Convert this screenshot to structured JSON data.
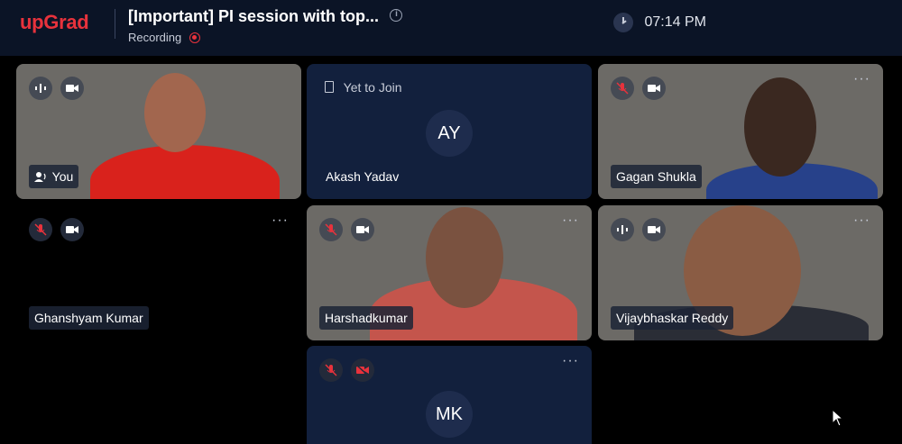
{
  "header": {
    "logo": "upGrad",
    "title": "[Important] PI session with top...",
    "recording_label": "Recording",
    "time": "07:14 PM"
  },
  "tiles": {
    "you": {
      "name": "You"
    },
    "akash": {
      "status": "Yet to Join",
      "initials": "AY",
      "name": "Akash Yadav"
    },
    "gagan": {
      "name": "Gagan Shukla"
    },
    "ghanshyam": {
      "name": "Ghanshyam Kumar"
    },
    "harshad": {
      "name": "Harshadkumar"
    },
    "vijay": {
      "name": "Vijaybhaskar Reddy"
    },
    "mk": {
      "initials": "MK"
    }
  },
  "more_menu": "···",
  "colors": {
    "brand": "#e8323c",
    "tile_navy": "#12203d",
    "topbar": "#0b1426"
  }
}
